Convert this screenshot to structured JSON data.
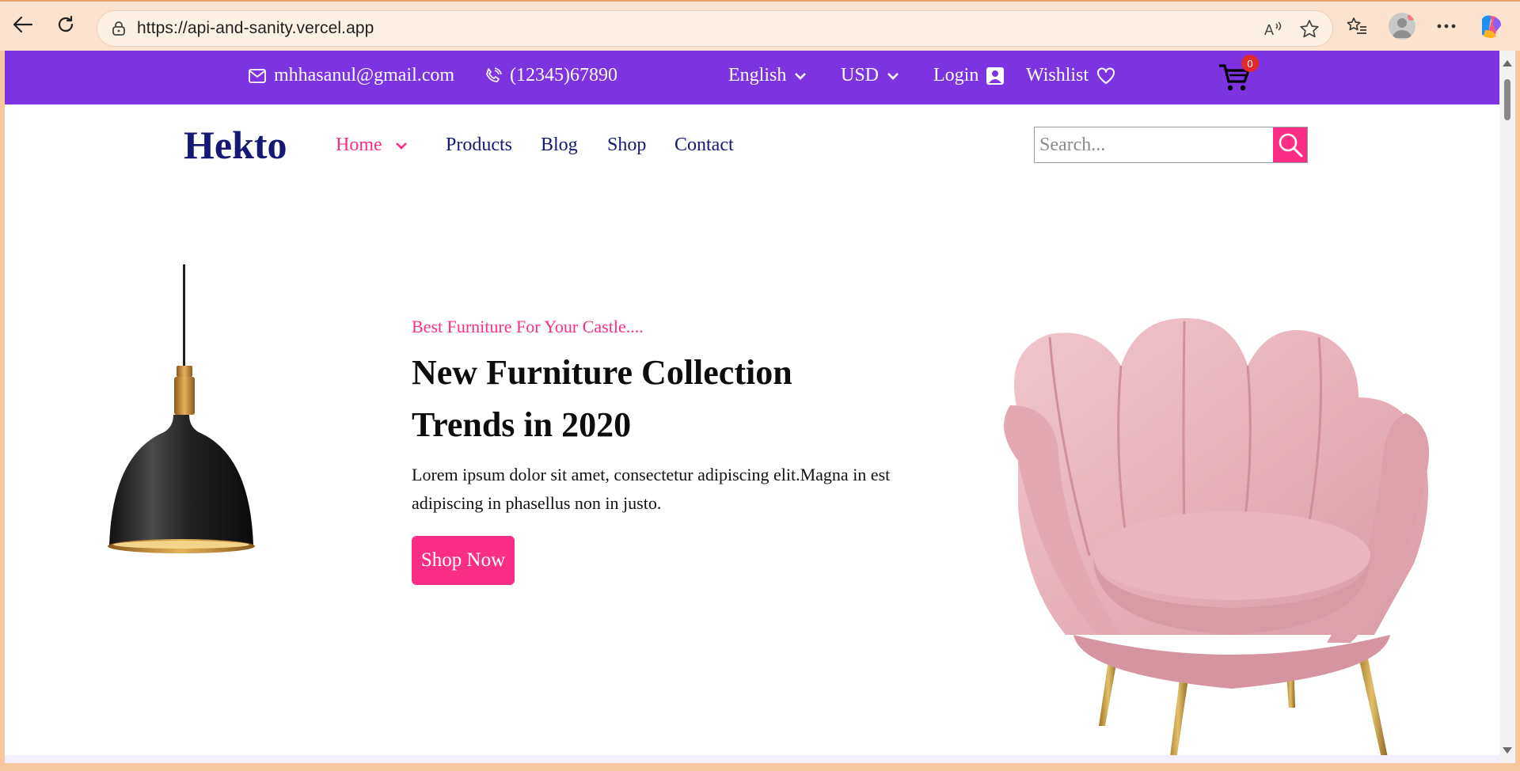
{
  "browser": {
    "url": "https://api-and-sanity.vercel.app"
  },
  "topbar": {
    "email": "mhhasanul@gmail.com",
    "phone": "(12345)67890",
    "language": "English",
    "currency": "USD",
    "login": "Login",
    "wishlist": "Wishlist",
    "cart_count": "0"
  },
  "nav": {
    "logo": "Hekto",
    "items": [
      "Home",
      "Products",
      "Blog",
      "Shop",
      "Contact"
    ],
    "search_placeholder": "Search..."
  },
  "hero": {
    "tagline": "Best Furniture For Your Castle....",
    "title": "New Furniture Collection Trends in 2020",
    "description": "Lorem ipsum dolor sit amet, consectetur adipiscing elit.Magna in est adipiscing in phasellus non in justo.",
    "button": "Shop Now"
  },
  "colors": {
    "topbar": "#7e33e0",
    "accent": "#fb2e86",
    "navy": "#151875"
  }
}
